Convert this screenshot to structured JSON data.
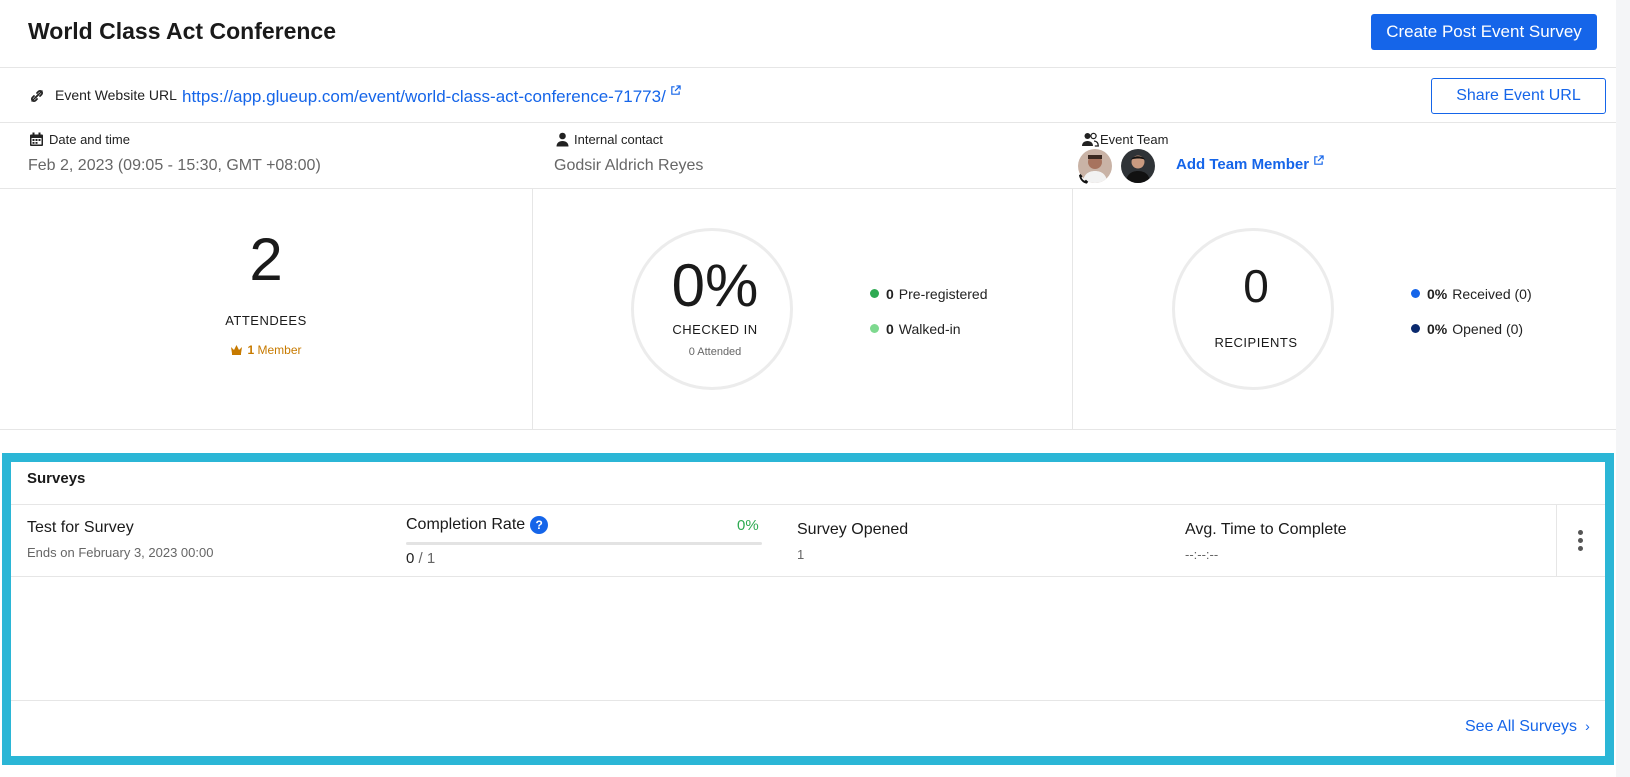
{
  "header": {
    "title": "World Class Act Conference",
    "create_survey_label": "Create Post Event Survey"
  },
  "event_url": {
    "label": "Event Website URL",
    "url": "https://app.glueup.com/event/world-class-act-conference-71773/",
    "share_label": "Share Event URL"
  },
  "info": {
    "date_label": "Date and time",
    "date_value": "Feb 2, 2023 (09:05 - 15:30, GMT +08:00)",
    "contact_label": "Internal contact",
    "contact_value": "Godsir Aldrich Reyes",
    "team_label": "Event Team",
    "add_member_label": "Add Team Member"
  },
  "stats": {
    "attendees": {
      "count": "2",
      "label": "ATTENDEES",
      "member_count": "1",
      "member_label": "Member"
    },
    "checked_in": {
      "percent": "0%",
      "label": "CHECKED IN",
      "attended": "0 Attended",
      "pre_registered": {
        "value": "0",
        "label": "Pre-registered",
        "color": "#2eaa52"
      },
      "walked_in": {
        "value": "0",
        "label": "Walked-in",
        "color": "#7ed98f"
      }
    },
    "recipients": {
      "count": "0",
      "label": "RECIPIENTS",
      "received": {
        "value": "0%",
        "label": "Received (0)",
        "color": "#1565e9"
      },
      "opened": {
        "value": "0%",
        "label": "Opened (0)",
        "color": "#0b2a6e"
      }
    }
  },
  "surveys": {
    "title": "Surveys",
    "items": [
      {
        "name": "Test for Survey",
        "ends": "Ends on February 3, 2023 00:00",
        "completion_label": "Completion Rate",
        "completion_pct": "0%",
        "completion_fraction": 0,
        "completed": "0",
        "total": "1",
        "opened_label": "Survey Opened",
        "opened_value": "1",
        "avg_time_label": "Avg. Time to Complete",
        "avg_time_value": "--:--:--"
      }
    ],
    "see_all_label": "See All Surveys"
  },
  "colors": {
    "accent": "#1565e9",
    "highlight": "#2bb6d6",
    "success": "#2eaa52",
    "member": "#c77a00"
  }
}
